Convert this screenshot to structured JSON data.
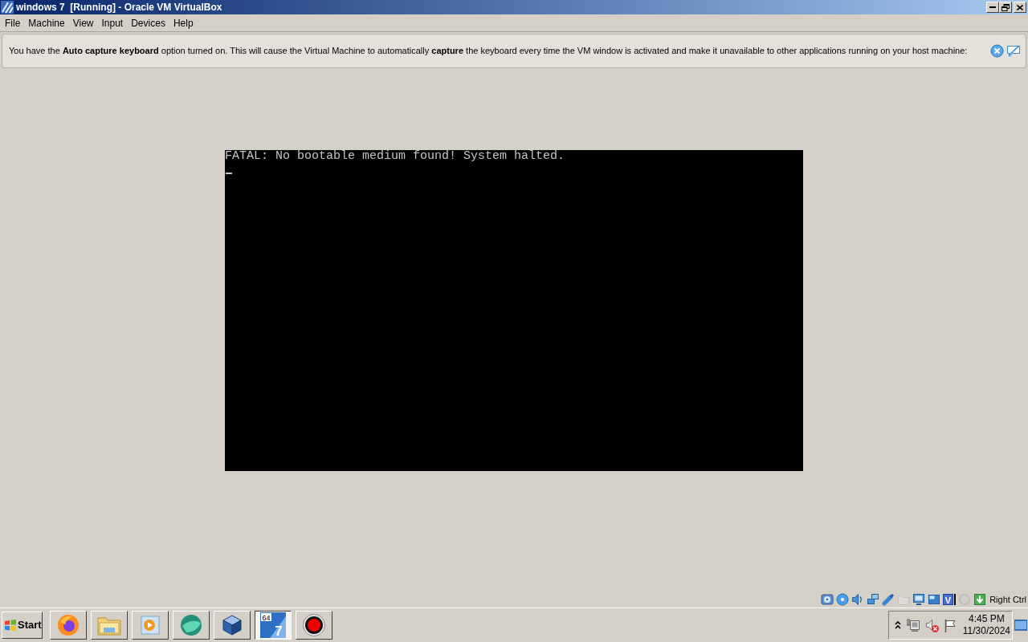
{
  "window": {
    "title": "windows 7  [Running] - Oracle VM VirtualBox"
  },
  "menu": [
    "File",
    "Machine",
    "View",
    "Input",
    "Devices",
    "Help"
  ],
  "notification": {
    "text": "You have the **Auto capture keyboard** option turned on. This will cause the Virtual Machine to automatically **capture** the keyboard every time the VM window is activated and make it unavailable to other applications running on your host machine:"
  },
  "vm_screen": {
    "lines": [
      "FATAL: No bootable medium found! System halted."
    ],
    "cursor_visible": true
  },
  "status_bar": {
    "indicators": [
      {
        "kind": "disk",
        "disabled": false
      },
      {
        "kind": "optical",
        "disabled": false
      },
      {
        "kind": "audio",
        "disabled": false
      },
      {
        "kind": "network",
        "disabled": false
      },
      {
        "kind": "usb",
        "disabled": false
      },
      {
        "kind": "shared",
        "disabled": true
      },
      {
        "kind": "display",
        "disabled": false
      },
      {
        "kind": "capture",
        "disabled": false
      },
      {
        "kind": "vt",
        "disabled": false,
        "glyph": "V"
      },
      {
        "kind": "mouse",
        "disabled": true
      },
      {
        "kind": "keyboard",
        "disabled": false
      }
    ],
    "host_key": "Right Ctrl"
  },
  "taskbar": {
    "start": "Start",
    "buttons": [
      {
        "kind": "browser",
        "selected": false
      },
      {
        "kind": "folder",
        "selected": false
      },
      {
        "kind": "media",
        "selected": false
      },
      {
        "kind": "sphere",
        "selected": false
      },
      {
        "kind": "cube",
        "selected": false
      },
      {
        "kind": "tile",
        "selected": true,
        "icon_text": [
          "64",
          "7"
        ]
      },
      {
        "kind": "record",
        "selected": false
      }
    ]
  },
  "tray": {
    "icons": [
      {
        "kind": "expand"
      },
      {
        "kind": "network"
      },
      {
        "kind": "volume",
        "muted": true
      },
      {
        "kind": "flag"
      }
    ],
    "time": "4:45 PM",
    "date": "11/30/2024"
  }
}
